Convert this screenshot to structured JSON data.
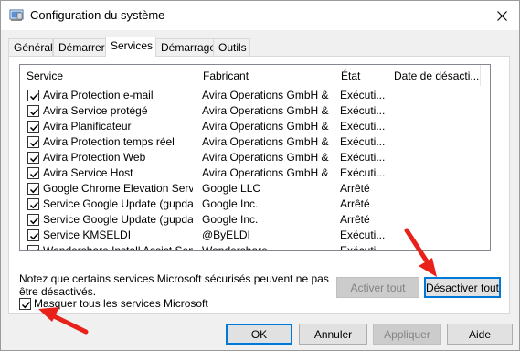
{
  "window": {
    "title": "Configuration du système"
  },
  "tabs": [
    {
      "label": "Général"
    },
    {
      "label": "Démarrer"
    },
    {
      "label": "Services"
    },
    {
      "label": "Démarrage"
    },
    {
      "label": "Outils"
    }
  ],
  "active_tab": "Services",
  "table": {
    "columns": [
      "Service",
      "Fabricant",
      "État",
      "Date de désacti..."
    ],
    "rows": [
      {
        "service": "Avira Protection e-mail",
        "fabricant": "Avira Operations GmbH & ...",
        "etat": "Exécuti...",
        "checked": true
      },
      {
        "service": "Avira Service protégé",
        "fabricant": "Avira Operations GmbH & ...",
        "etat": "Exécuti...",
        "checked": true
      },
      {
        "service": "Avira Planificateur",
        "fabricant": "Avira Operations GmbH & ...",
        "etat": "Exécuti...",
        "checked": true
      },
      {
        "service": "Avira Protection temps réel",
        "fabricant": "Avira Operations GmbH & ...",
        "etat": "Exécuti...",
        "checked": true
      },
      {
        "service": "Avira Protection Web",
        "fabricant": "Avira Operations GmbH & ...",
        "etat": "Exécuti...",
        "checked": true
      },
      {
        "service": "Avira Service Host",
        "fabricant": "Avira Operations GmbH & ...",
        "etat": "Exécuti...",
        "checked": true
      },
      {
        "service": "Google Chrome Elevation Servic...",
        "fabricant": "Google LLC",
        "etat": "Arrêté",
        "checked": true
      },
      {
        "service": "Service Google Update (gupdate)",
        "fabricant": "Google Inc.",
        "etat": "Arrêté",
        "checked": true
      },
      {
        "service": "Service Google Update (gupdatem)",
        "fabricant": "Google Inc.",
        "etat": "Arrêté",
        "checked": true
      },
      {
        "service": "Service KMSELDI",
        "fabricant": "@ByELDI",
        "etat": "Exécuti...",
        "checked": true
      },
      {
        "service": "Wondershare Install Assist Service",
        "fabricant": "Wondershare",
        "etat": "Exécuti...",
        "checked": true
      }
    ]
  },
  "note": "Notez que certains services Microsoft sécurisés peuvent ne pas être désactivés.",
  "buttons": {
    "activer_tout": "Activer tout",
    "desactiver_tout": "Désactiver tout",
    "ok": "OK",
    "annuler": "Annuler",
    "appliquer": "Appliquer",
    "aide": "Aide"
  },
  "masquer": {
    "label": "Masquer tous les services Microsoft",
    "checked": true
  },
  "colors": {
    "arrow": "#e8221b",
    "focus": "#0078d7"
  }
}
